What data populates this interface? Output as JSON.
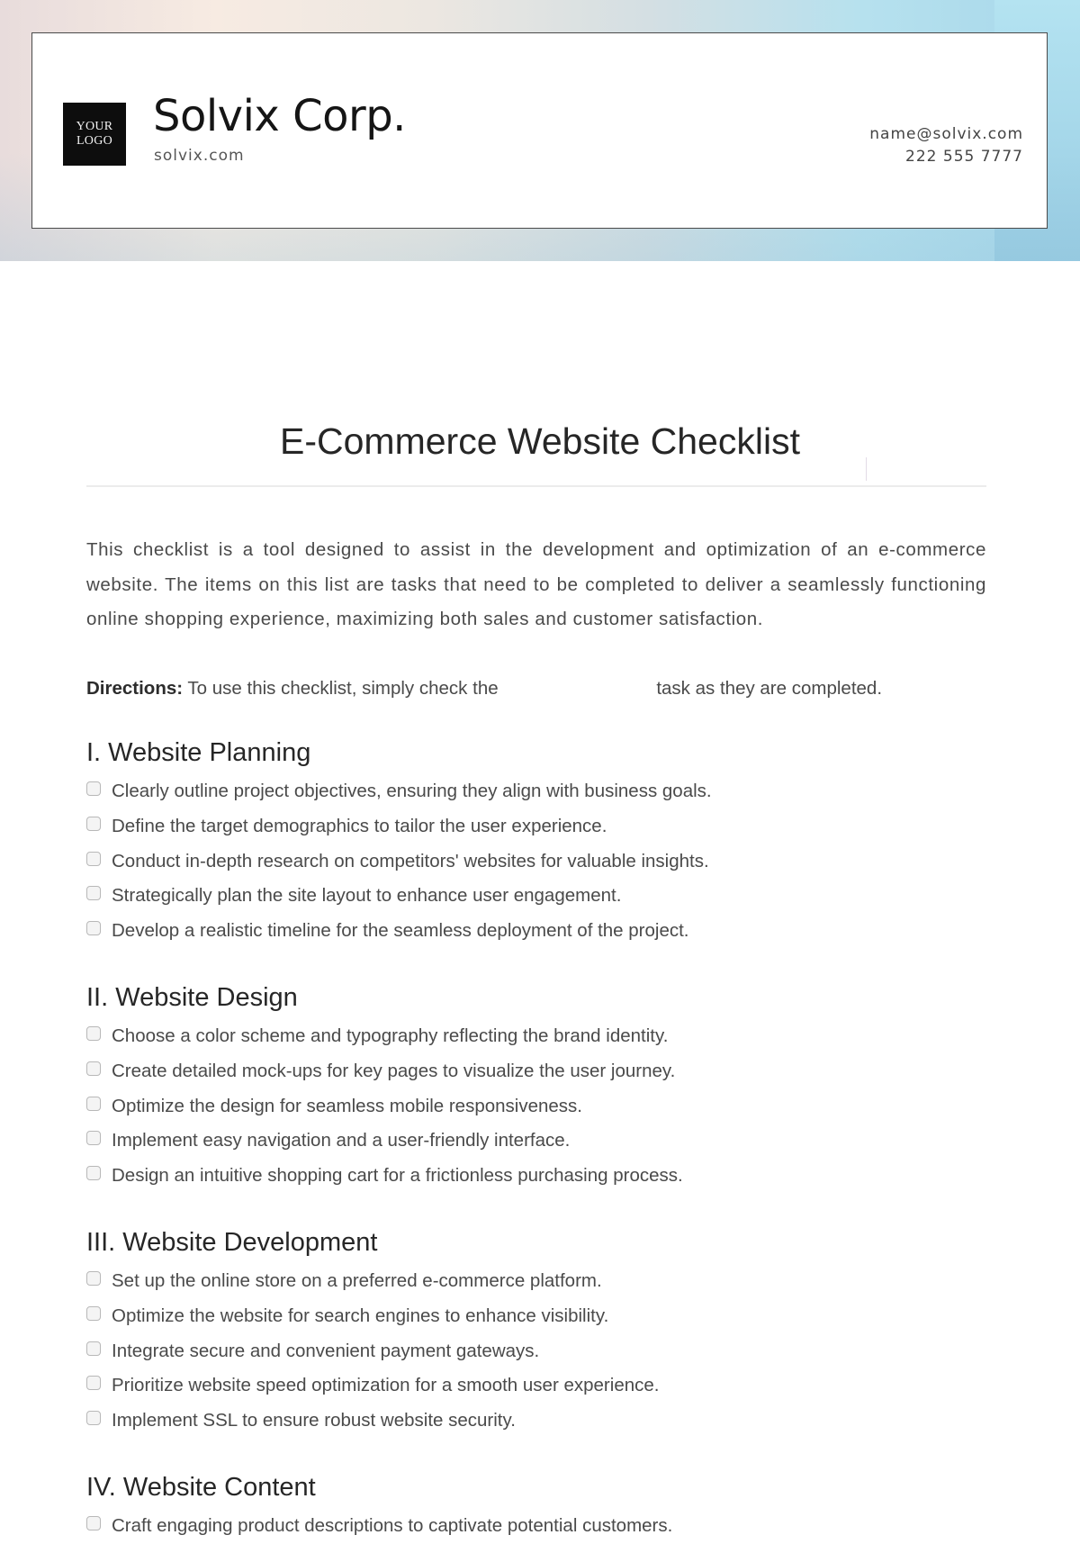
{
  "header": {
    "logo_line1": "YOUR",
    "logo_line2": "LOGO",
    "company_name": "Solvix Corp.",
    "website": "solvix.com",
    "email": "name@solvix.com",
    "phone": "222 555 7777"
  },
  "document": {
    "title": "E-Commerce Website Checklist",
    "intro": "This checklist is a tool designed to assist in the development and optimization of an e-commerce website. The items on this list are tasks that need to be completed to deliver a seamlessly functioning online shopping experience, maximizing both sales and customer satisfaction.",
    "directions_label": "Directions:",
    "directions_text_before": " To use this checklist, simply check the ",
    "directions_text_after": "task as they are completed."
  },
  "sections": [
    {
      "title": "I. Website Planning",
      "items": [
        {
          "label": "Clearly outline project objectives, ensuring they align with business goals.",
          "checked": false
        },
        {
          "label": "Define the target demographics to tailor the user experience.",
          "checked": false
        },
        {
          "label": "Conduct in-depth research on competitors' websites for valuable insights.",
          "checked": false
        },
        {
          "label": "Strategically plan the site layout to enhance user engagement.",
          "checked": false
        },
        {
          "label": "Develop a realistic timeline for the seamless deployment of the project.",
          "checked": false
        }
      ]
    },
    {
      "title": "II. Website Design",
      "items": [
        {
          "label": "Choose a color scheme and typography reflecting the brand identity.",
          "checked": false
        },
        {
          "label": "Create detailed mock-ups for key pages to visualize the user journey.",
          "checked": false
        },
        {
          "label": "Optimize the design for seamless mobile responsiveness.",
          "checked": false
        },
        {
          "label": "Implement easy navigation and a user-friendly interface.",
          "checked": false
        },
        {
          "label": "Design an intuitive shopping cart for a frictionless purchasing process.",
          "checked": false
        }
      ]
    },
    {
      "title": "III. Website Development",
      "items": [
        {
          "label": "Set up the online store on a preferred e-commerce platform.",
          "checked": false
        },
        {
          "label": "Optimize the website for search engines to enhance visibility.",
          "checked": false
        },
        {
          "label": "Integrate secure and convenient payment gateways.",
          "checked": false
        },
        {
          "label": "Prioritize website speed optimization for a smooth user experience.",
          "checked": false
        },
        {
          "label": "Implement SSL to ensure robust website security.",
          "checked": false
        }
      ]
    },
    {
      "title": "IV. Website Content",
      "items": [
        {
          "label": "Craft engaging product descriptions to captivate potential customers.",
          "checked": false
        }
      ]
    }
  ]
}
